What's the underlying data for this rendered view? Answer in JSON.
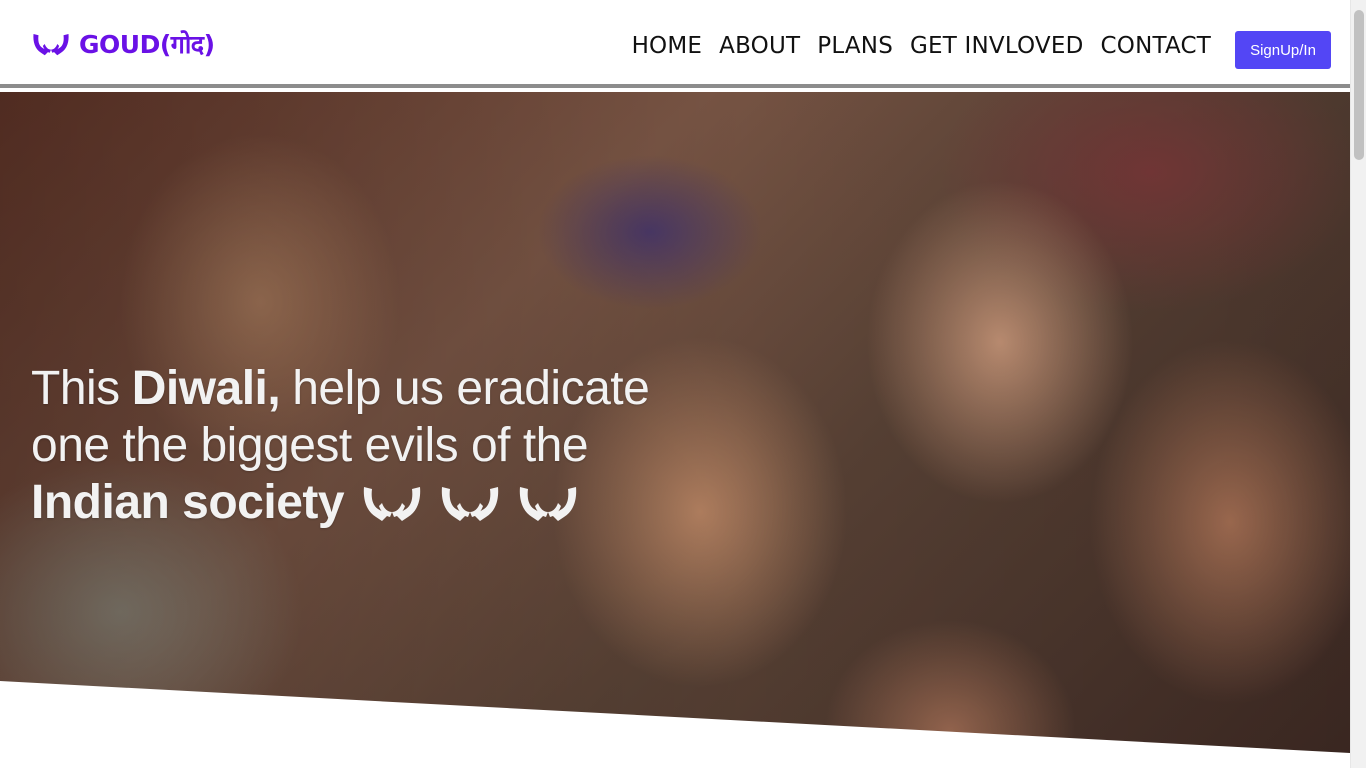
{
  "brand": {
    "name": "GOUD(गोद)",
    "logo_icon": "hands-icon",
    "color": "#6a11e6"
  },
  "nav": {
    "items": [
      "HOME",
      "ABOUT",
      "PLANS",
      "GET INVLOVED",
      "CONTACT"
    ],
    "signup_label": "SignUp/In",
    "signup_color": "#5346f5"
  },
  "hero": {
    "line1_part1": "This",
    "line1_bold": "Diwali,",
    "line1_part2": "help us eradicate",
    "line2": "one the biggest evils of the",
    "line3_bold": "Indian society",
    "decor_icons": [
      "hands-icon",
      "hands-icon",
      "hands-icon"
    ]
  }
}
